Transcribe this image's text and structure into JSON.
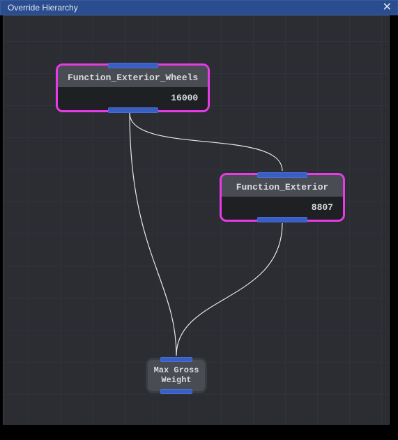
{
  "window": {
    "title": "Override Hierarchy"
  },
  "nodes": {
    "wheels": {
      "title": "Function_Exterior_Wheels",
      "value": "16000",
      "selected": true
    },
    "exterior": {
      "title": "Function_Exterior",
      "value": "8807",
      "selected": true
    },
    "maxgross": {
      "title": "Max Gross Weight",
      "selected": false
    }
  },
  "colors": {
    "accent": "#3a5fc4",
    "selection": "#e83ae8",
    "edge": "#e8e8e8"
  }
}
